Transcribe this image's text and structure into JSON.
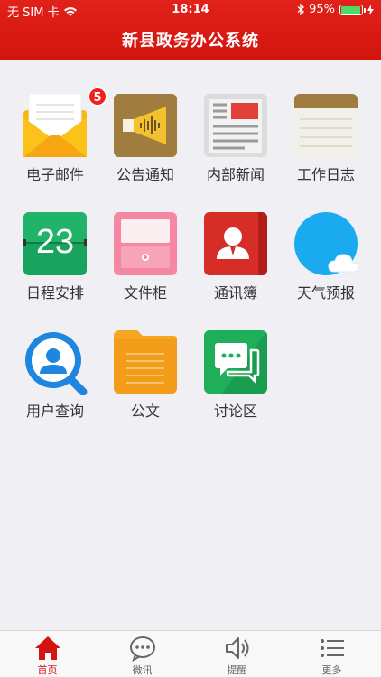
{
  "status_bar": {
    "carrier": "无 SIM 卡",
    "time": "18:14",
    "battery": "95%",
    "battery_level": 0.95
  },
  "header": {
    "title": "新县政务办公系统"
  },
  "apps": [
    {
      "label": "电子邮件",
      "icon": "mail-icon",
      "badge": "5"
    },
    {
      "label": "公告通知",
      "icon": "announcement-icon"
    },
    {
      "label": "内部新闻",
      "icon": "news-icon"
    },
    {
      "label": "工作日志",
      "icon": "notebook-icon"
    },
    {
      "label": "日程安排",
      "icon": "calendar-icon",
      "calendar_day": "23"
    },
    {
      "label": "文件柜",
      "icon": "cabinet-icon"
    },
    {
      "label": "通讯簿",
      "icon": "contacts-icon"
    },
    {
      "label": "天气预报",
      "icon": "weather-icon"
    },
    {
      "label": "用户查询",
      "icon": "user-search-icon"
    },
    {
      "label": "公文",
      "icon": "folder-icon"
    },
    {
      "label": "讨论区",
      "icon": "chat-icon"
    }
  ],
  "tabbar": {
    "items": [
      {
        "label": "首页",
        "icon": "home-icon",
        "active": true
      },
      {
        "label": "微讯",
        "icon": "message-icon"
      },
      {
        "label": "提醒",
        "icon": "speaker-icon"
      },
      {
        "label": "更多",
        "icon": "list-icon"
      }
    ]
  },
  "colors": {
    "brand_red": "#d4140f",
    "background": "#efeff4"
  }
}
